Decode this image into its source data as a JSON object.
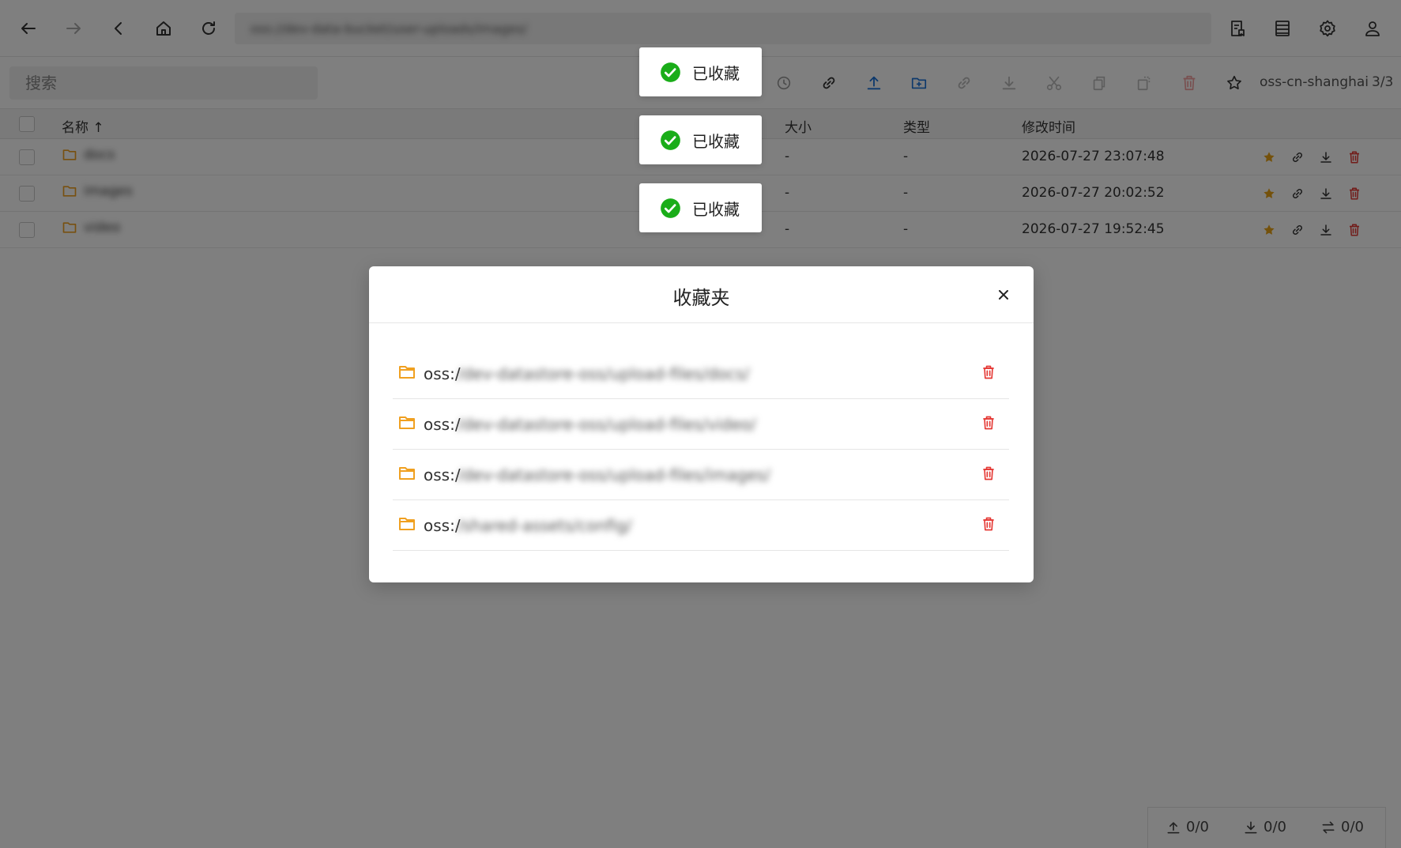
{
  "topbar": {
    "address_value": "oss://dev-data-bucket/user-uploads/images/",
    "nav_icons": [
      "back-arrow-icon",
      "forward-arrow-icon",
      "chevron-left-icon",
      "home-icon",
      "refresh-icon"
    ],
    "right_icons": [
      "bookmark-list-icon",
      "list-view-icon",
      "gear-icon",
      "user-icon"
    ]
  },
  "toolbar": {
    "search_placeholder": "搜索",
    "region": "oss-cn-shanghai",
    "count": "3/3"
  },
  "table": {
    "headers": {
      "name": "名称 ↑",
      "size": "大小",
      "type": "类型",
      "modified": "修改时间"
    },
    "rows": [
      {
        "name": "docs",
        "size": "-",
        "type": "-",
        "modified": "2026-07-27 23:07:48"
      },
      {
        "name": "images",
        "size": "-",
        "type": "-",
        "modified": "2026-07-27 20:02:52"
      },
      {
        "name": "video",
        "size": "-",
        "type": "-",
        "modified": "2026-07-27 19:52:45"
      }
    ]
  },
  "transfer": {
    "upload": "0/0",
    "download": "0/0",
    "copy": "0/0"
  },
  "modal": {
    "title": "收藏夹",
    "items": [
      {
        "prefix": "oss:/",
        "path": "/dev-datastore-oss/upload-files/docs/"
      },
      {
        "prefix": "oss:/",
        "path": "/dev-datastore-oss/upload-files/video/"
      },
      {
        "prefix": "oss:/",
        "path": "/dev-datastore-oss/upload-files/images/"
      },
      {
        "prefix": "oss:/",
        "path": "/shared-assets/config/"
      }
    ]
  },
  "toasts": [
    "已收藏",
    "已收藏",
    "已收藏"
  ],
  "colors": {
    "accent_blue": "#1a73d9",
    "folder_orange": "#f0a020",
    "danger_red": "#e53935",
    "star_gold": "#e8a317",
    "success_green": "#1aad19",
    "overlay": "rgba(0,0,0,0.5)"
  }
}
